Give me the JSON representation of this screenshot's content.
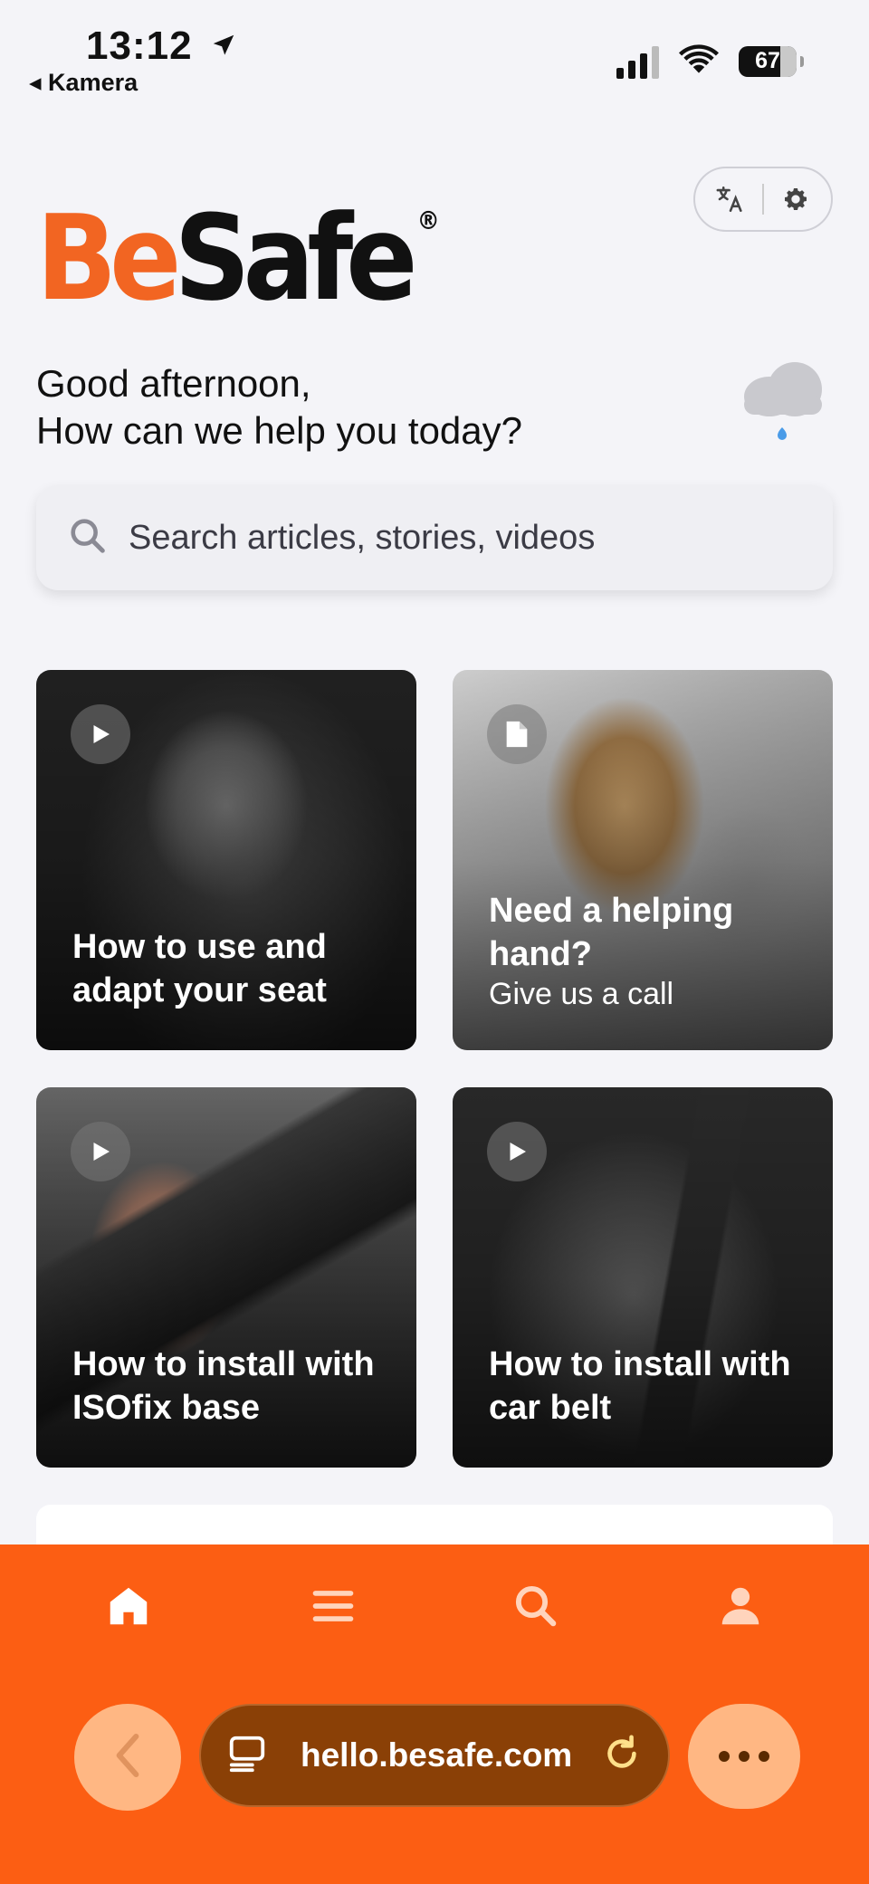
{
  "status_bar": {
    "time": "13:12",
    "back_app": "◂ Kamera",
    "battery": "67"
  },
  "header": {
    "logo_be": "Be",
    "logo_safe": "Safe",
    "logo_reg": "®",
    "greeting_line1": "Good afternoon,",
    "greeting_line2": "How can we help you today?"
  },
  "search": {
    "placeholder": "Search articles, stories, videos"
  },
  "cards": [
    {
      "title": "How to use and adapt your seat",
      "kind": "video",
      "icon": "play-icon"
    },
    {
      "title": "Need a helping hand?",
      "subtitle": "Give us a call",
      "kind": "article",
      "icon": "document-icon"
    },
    {
      "title": "How to install with ISOfix base",
      "kind": "video",
      "icon": "play-icon"
    },
    {
      "title": "How to install with car belt",
      "kind": "video",
      "icon": "play-icon"
    }
  ],
  "bottom_nav": {
    "items": [
      "home-icon",
      "menu-icon",
      "search-icon",
      "profile-icon"
    ],
    "active": "home-icon"
  },
  "browser": {
    "url": "hello.besafe.com"
  },
  "colors": {
    "brand_orange": "#fc5e13",
    "logo_orange": "#f26522",
    "url_bar": "#8a4006",
    "button_peach": "#ffb783"
  }
}
